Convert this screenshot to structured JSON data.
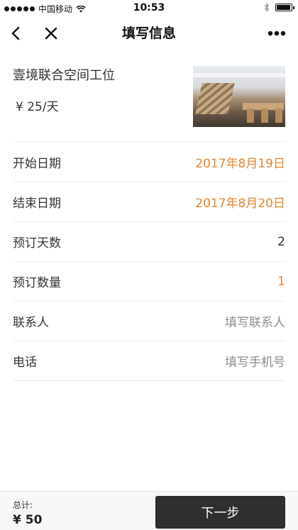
{
  "status_bar": {
    "carrier": "中国移动",
    "time": "10:53"
  },
  "nav": {
    "title": "填写信息",
    "back_icon": "back-arrow-icon",
    "close_icon": "close-icon",
    "more_icon": "more-dots-icon"
  },
  "product": {
    "name": "壹境联合空间工位",
    "price": "¥ 25/天"
  },
  "form": {
    "rows": [
      {
        "label": "开始日期",
        "value": "2017年8月19日",
        "style": "orange"
      },
      {
        "label": "结束日期",
        "value": "2017年8月20日",
        "style": "orange"
      },
      {
        "label": "预订天数",
        "value": "2",
        "style": "normal"
      },
      {
        "label": "预订数量",
        "value": "1",
        "style": "orange"
      },
      {
        "label": "联系人",
        "value": "填写联系人",
        "style": "placeholder"
      },
      {
        "label": "电话",
        "value": "填写手机号",
        "style": "placeholder"
      }
    ]
  },
  "footer": {
    "total_label": "总计:",
    "total_amount": "¥ 50",
    "next_label": "下一步"
  },
  "colors": {
    "accent": "#e1872f",
    "button_bg": "#2f2f2f"
  }
}
